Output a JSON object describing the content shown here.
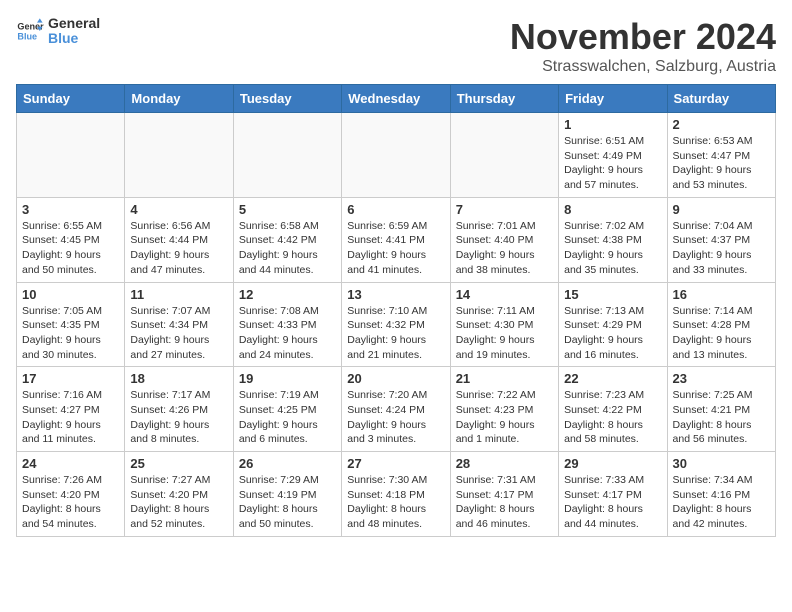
{
  "logo": {
    "line1": "General",
    "line2": "Blue"
  },
  "title": "November 2024",
  "location": "Strasswalchen, Salzburg, Austria",
  "weekdays": [
    "Sunday",
    "Monday",
    "Tuesday",
    "Wednesday",
    "Thursday",
    "Friday",
    "Saturday"
  ],
  "weeks": [
    [
      {
        "day": "",
        "info": ""
      },
      {
        "day": "",
        "info": ""
      },
      {
        "day": "",
        "info": ""
      },
      {
        "day": "",
        "info": ""
      },
      {
        "day": "",
        "info": ""
      },
      {
        "day": "1",
        "info": "Sunrise: 6:51 AM\nSunset: 4:49 PM\nDaylight: 9 hours and 57 minutes."
      },
      {
        "day": "2",
        "info": "Sunrise: 6:53 AM\nSunset: 4:47 PM\nDaylight: 9 hours and 53 minutes."
      }
    ],
    [
      {
        "day": "3",
        "info": "Sunrise: 6:55 AM\nSunset: 4:45 PM\nDaylight: 9 hours and 50 minutes."
      },
      {
        "day": "4",
        "info": "Sunrise: 6:56 AM\nSunset: 4:44 PM\nDaylight: 9 hours and 47 minutes."
      },
      {
        "day": "5",
        "info": "Sunrise: 6:58 AM\nSunset: 4:42 PM\nDaylight: 9 hours and 44 minutes."
      },
      {
        "day": "6",
        "info": "Sunrise: 6:59 AM\nSunset: 4:41 PM\nDaylight: 9 hours and 41 minutes."
      },
      {
        "day": "7",
        "info": "Sunrise: 7:01 AM\nSunset: 4:40 PM\nDaylight: 9 hours and 38 minutes."
      },
      {
        "day": "8",
        "info": "Sunrise: 7:02 AM\nSunset: 4:38 PM\nDaylight: 9 hours and 35 minutes."
      },
      {
        "day": "9",
        "info": "Sunrise: 7:04 AM\nSunset: 4:37 PM\nDaylight: 9 hours and 33 minutes."
      }
    ],
    [
      {
        "day": "10",
        "info": "Sunrise: 7:05 AM\nSunset: 4:35 PM\nDaylight: 9 hours and 30 minutes."
      },
      {
        "day": "11",
        "info": "Sunrise: 7:07 AM\nSunset: 4:34 PM\nDaylight: 9 hours and 27 minutes."
      },
      {
        "day": "12",
        "info": "Sunrise: 7:08 AM\nSunset: 4:33 PM\nDaylight: 9 hours and 24 minutes."
      },
      {
        "day": "13",
        "info": "Sunrise: 7:10 AM\nSunset: 4:32 PM\nDaylight: 9 hours and 21 minutes."
      },
      {
        "day": "14",
        "info": "Sunrise: 7:11 AM\nSunset: 4:30 PM\nDaylight: 9 hours and 19 minutes."
      },
      {
        "day": "15",
        "info": "Sunrise: 7:13 AM\nSunset: 4:29 PM\nDaylight: 9 hours and 16 minutes."
      },
      {
        "day": "16",
        "info": "Sunrise: 7:14 AM\nSunset: 4:28 PM\nDaylight: 9 hours and 13 minutes."
      }
    ],
    [
      {
        "day": "17",
        "info": "Sunrise: 7:16 AM\nSunset: 4:27 PM\nDaylight: 9 hours and 11 minutes."
      },
      {
        "day": "18",
        "info": "Sunrise: 7:17 AM\nSunset: 4:26 PM\nDaylight: 9 hours and 8 minutes."
      },
      {
        "day": "19",
        "info": "Sunrise: 7:19 AM\nSunset: 4:25 PM\nDaylight: 9 hours and 6 minutes."
      },
      {
        "day": "20",
        "info": "Sunrise: 7:20 AM\nSunset: 4:24 PM\nDaylight: 9 hours and 3 minutes."
      },
      {
        "day": "21",
        "info": "Sunrise: 7:22 AM\nSunset: 4:23 PM\nDaylight: 9 hours and 1 minute."
      },
      {
        "day": "22",
        "info": "Sunrise: 7:23 AM\nSunset: 4:22 PM\nDaylight: 8 hours and 58 minutes."
      },
      {
        "day": "23",
        "info": "Sunrise: 7:25 AM\nSunset: 4:21 PM\nDaylight: 8 hours and 56 minutes."
      }
    ],
    [
      {
        "day": "24",
        "info": "Sunrise: 7:26 AM\nSunset: 4:20 PM\nDaylight: 8 hours and 54 minutes."
      },
      {
        "day": "25",
        "info": "Sunrise: 7:27 AM\nSunset: 4:20 PM\nDaylight: 8 hours and 52 minutes."
      },
      {
        "day": "26",
        "info": "Sunrise: 7:29 AM\nSunset: 4:19 PM\nDaylight: 8 hours and 50 minutes."
      },
      {
        "day": "27",
        "info": "Sunrise: 7:30 AM\nSunset: 4:18 PM\nDaylight: 8 hours and 48 minutes."
      },
      {
        "day": "28",
        "info": "Sunrise: 7:31 AM\nSunset: 4:17 PM\nDaylight: 8 hours and 46 minutes."
      },
      {
        "day": "29",
        "info": "Sunrise: 7:33 AM\nSunset: 4:17 PM\nDaylight: 8 hours and 44 minutes."
      },
      {
        "day": "30",
        "info": "Sunrise: 7:34 AM\nSunset: 4:16 PM\nDaylight: 8 hours and 42 minutes."
      }
    ]
  ]
}
